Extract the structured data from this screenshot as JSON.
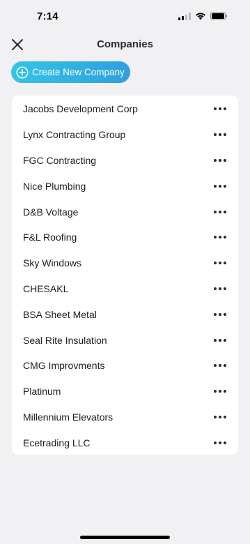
{
  "status_bar": {
    "time": "7:14",
    "icons": [
      "cellular-signal-icon",
      "wifi-icon",
      "battery-icon"
    ]
  },
  "nav": {
    "title": "Companies",
    "close_icon": "close-icon"
  },
  "create_button": {
    "label": "Create New Company",
    "icon": "plus-circle-icon",
    "color_start": "#34c4e6",
    "color_end": "#2f9fdf"
  },
  "companies": [
    {
      "name": "Jacobs Development Corp"
    },
    {
      "name": "Lynx Contracting Group"
    },
    {
      "name": "FGC Contracting"
    },
    {
      "name": "Nice Plumbing"
    },
    {
      "name": "D&B Voltage"
    },
    {
      "name": "F&L Roofing"
    },
    {
      "name": "Sky Windows"
    },
    {
      "name": "CHESAKL"
    },
    {
      "name": "BSA Sheet Metal"
    },
    {
      "name": "Seal Rite Insulation"
    },
    {
      "name": "CMG Improvments"
    },
    {
      "name": "Platinum"
    },
    {
      "name": "Millennium Elevators"
    },
    {
      "name": "Ecetrading LLC"
    }
  ],
  "row_menu_icon": "more-horizontal-icon"
}
